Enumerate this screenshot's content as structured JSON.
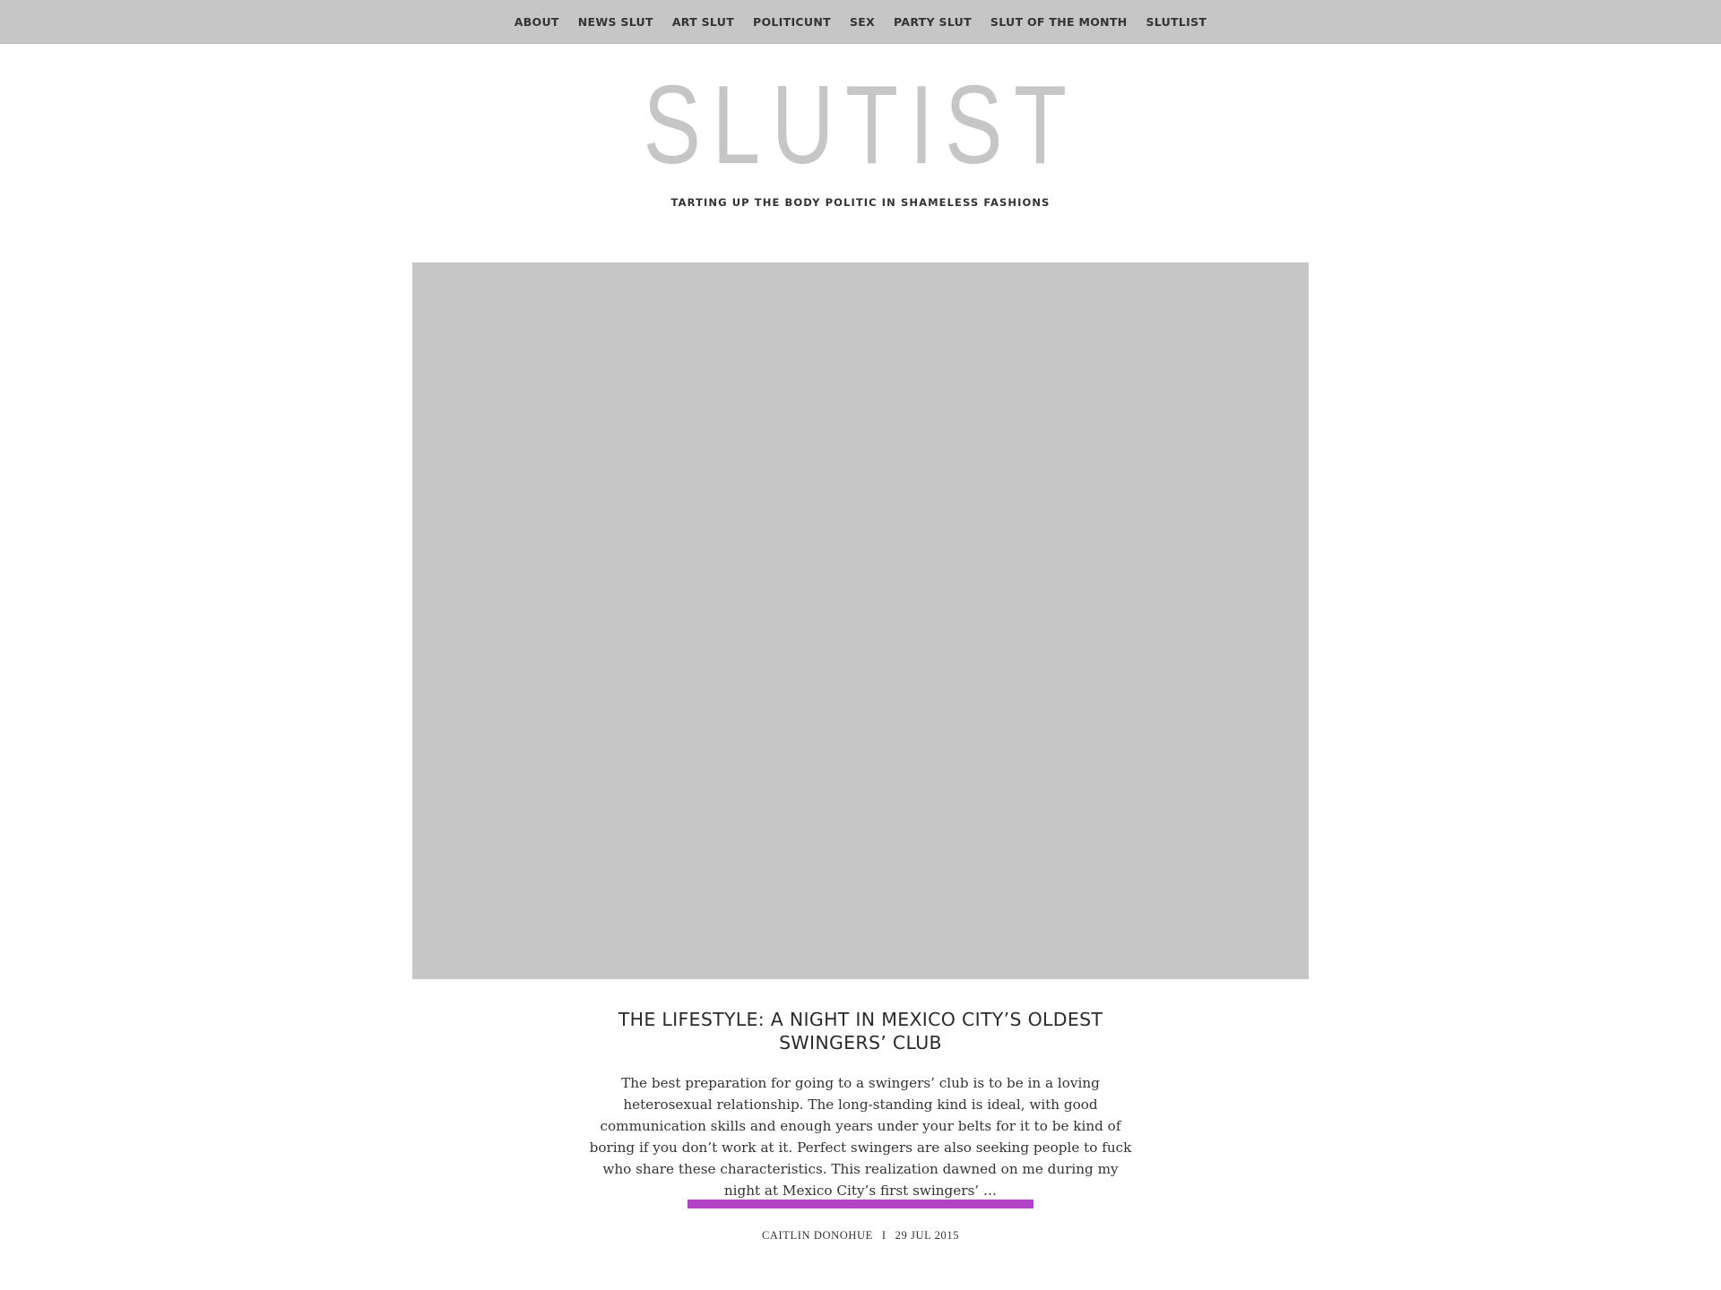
{
  "nav": {
    "items": [
      {
        "label": "ABOUT"
      },
      {
        "label": "NEWS SLUT"
      },
      {
        "label": "ART SLUT"
      },
      {
        "label": "POLITICUNT"
      },
      {
        "label": "SEX"
      },
      {
        "label": "PARTY SLUT"
      },
      {
        "label": "SLUT OF THE MONTH"
      },
      {
        "label": "SLUTLIST"
      }
    ]
  },
  "site": {
    "logo": "SLUTIST",
    "tagline": "TARTING UP THE BODY POLITIC IN SHAMELESS FASHIONS"
  },
  "post": {
    "title": "THE LIFESTYLE: A NIGHT IN MEXICO CITY’S OLDEST SWINGERS’ CLUB",
    "excerpt": "The best preparation for going to a swingers’ club is to be in a loving heterosexual relationship. The long-standing kind is ideal, with good communication skills and enough years under your belts for it to be kind of boring if you don’t work at it. Perfect swingers are also seeking people to fuck who share these characteristics. This realization dawned on me during my night at Mexico City’s first swingers’ …",
    "author": "CAITLIN DONOHUE",
    "separator": "I",
    "date": "29 JUL 2015"
  },
  "colors": {
    "topbar": "#c6c6c6",
    "logo": "#c6c6c6",
    "hero_placeholder": "#c6c6c6",
    "accent": "#b043c6",
    "text": "#333333"
  }
}
